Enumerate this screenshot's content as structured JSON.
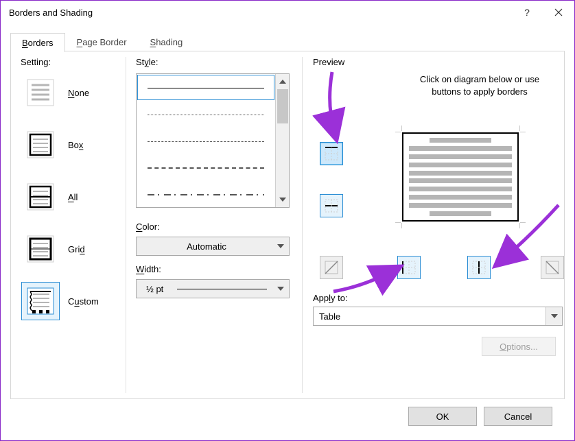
{
  "window": {
    "title": "Borders and Shading"
  },
  "tabs": {
    "borders": "Borders",
    "page_border": "Page Border",
    "shading": "Shading"
  },
  "setting": {
    "label": "Setting:",
    "items": [
      {
        "label": "None"
      },
      {
        "label": "Box"
      },
      {
        "label": "All"
      },
      {
        "label": "Grid"
      },
      {
        "label": "Custom"
      }
    ]
  },
  "style": {
    "label": "Style:"
  },
  "color": {
    "label": "Color:",
    "value": "Automatic"
  },
  "width": {
    "label": "Width:",
    "value": "½ pt"
  },
  "preview": {
    "label": "Preview",
    "hint": "Click on diagram below or use buttons to apply borders"
  },
  "apply": {
    "label": "Apply to:",
    "value": "Table"
  },
  "options": {
    "label": "Options..."
  },
  "footer": {
    "ok": "OK",
    "cancel": "Cancel"
  }
}
